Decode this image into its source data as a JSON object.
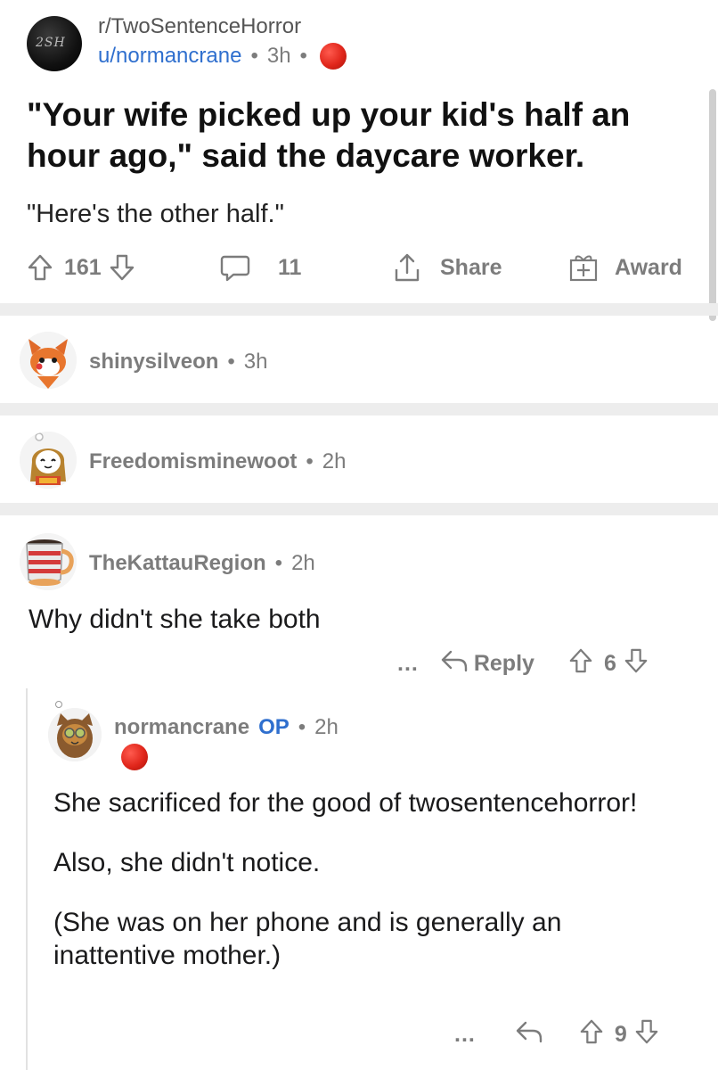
{
  "post": {
    "subreddit": "r/TwoSentenceHorror",
    "subreddit_icon_text": "2SH",
    "author": "u/normancrane",
    "time": "3h",
    "title": "\"Your wife picked up your kid's half an hour ago,\" said the daycare worker.",
    "body": "\"Here's the other half.\"",
    "upvotes": "161",
    "comments": "11",
    "share_label": "Share",
    "award_label": "Award"
  },
  "comments": [
    {
      "author": "shinysilveon",
      "time": "3h",
      "text": ""
    },
    {
      "author": "Freedomisminewoot",
      "time": "2h",
      "text": ""
    },
    {
      "author": "TheKattauRegion",
      "time": "2h",
      "text": "Why didn't she take both",
      "reply_label": "Reply",
      "score": "6",
      "more": "..."
    }
  ],
  "reply": {
    "author": "normancrane",
    "op_badge": "OP",
    "time": "2h",
    "paragraphs": [
      "She sacrificed for the good of twosentencehorror!",
      "Also, she didn't notice.",
      "(She was on her phone and is generally an inattentive mother.)"
    ],
    "score": "9",
    "more": "..."
  },
  "colors": {
    "accent_blue": "#2f6fce",
    "meta_gray": "#7c7c7c",
    "separator": "#ededed",
    "award_red": "#e0261b"
  }
}
